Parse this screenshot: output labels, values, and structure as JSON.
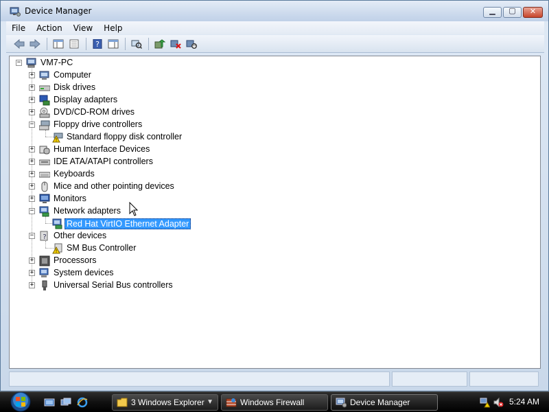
{
  "window": {
    "title": "Device Manager"
  },
  "menu": [
    "File",
    "Action",
    "View",
    "Help"
  ],
  "toolbar_icons": [
    "back-icon",
    "forward-icon",
    "show-hide-console-tree-icon",
    "properties-icon",
    "help-icon",
    "show-pane-icon",
    "scan-hardware-icon",
    "update-driver-icon",
    "uninstall-icon",
    "disable-icon"
  ],
  "tree": {
    "root": "VM7-PC",
    "items": [
      {
        "label": "Computer",
        "icon": "computer-icon",
        "expanded": false
      },
      {
        "label": "Disk drives",
        "icon": "disk-drive-icon",
        "expanded": false
      },
      {
        "label": "Display adapters",
        "icon": "display-adapter-icon",
        "expanded": false
      },
      {
        "label": "DVD/CD-ROM drives",
        "icon": "dvd-drive-icon",
        "expanded": false
      },
      {
        "label": "Floppy drive controllers",
        "icon": "floppy-controller-icon",
        "expanded": true,
        "children": [
          {
            "label": "Standard floppy disk controller",
            "icon": "warning-device-icon"
          }
        ]
      },
      {
        "label": "Human Interface Devices",
        "icon": "hid-icon",
        "expanded": false
      },
      {
        "label": "IDE ATA/ATAPI controllers",
        "icon": "ide-controller-icon",
        "expanded": false
      },
      {
        "label": "Keyboards",
        "icon": "keyboard-icon",
        "expanded": false
      },
      {
        "label": "Mice and other pointing devices",
        "icon": "mouse-icon",
        "expanded": false
      },
      {
        "label": "Monitors",
        "icon": "monitor-icon",
        "expanded": false
      },
      {
        "label": "Network adapters",
        "icon": "network-adapter-icon",
        "expanded": true,
        "children": [
          {
            "label": "Red Hat VirtIO Ethernet Adapter",
            "icon": "network-adapter-icon",
            "selected": true
          }
        ]
      },
      {
        "label": "Other devices",
        "icon": "unknown-device-icon",
        "expanded": true,
        "children": [
          {
            "label": "SM Bus Controller",
            "icon": "warning-device-icon"
          }
        ]
      },
      {
        "label": "Processors",
        "icon": "processor-icon",
        "expanded": false
      },
      {
        "label": "System devices",
        "icon": "system-device-icon",
        "expanded": false
      },
      {
        "label": "Universal Serial Bus controllers",
        "icon": "usb-icon",
        "expanded": false
      }
    ]
  },
  "taskbar": {
    "buttons": [
      {
        "label": "3 Windows Explorer",
        "icon": "folder-icon",
        "has_menu": true
      },
      {
        "label": "Windows Firewall",
        "icon": "firewall-icon",
        "has_menu": false
      },
      {
        "label": "Device Manager",
        "icon": "device-manager-icon",
        "active": true
      }
    ],
    "clock": "5:24 AM",
    "tray_icons": [
      "network-warning-icon",
      "volume-muted-icon"
    ]
  },
  "colors": {
    "selection": "#3399ff",
    "window_frame": "#c9d8ea",
    "taskbar": "#111111"
  }
}
